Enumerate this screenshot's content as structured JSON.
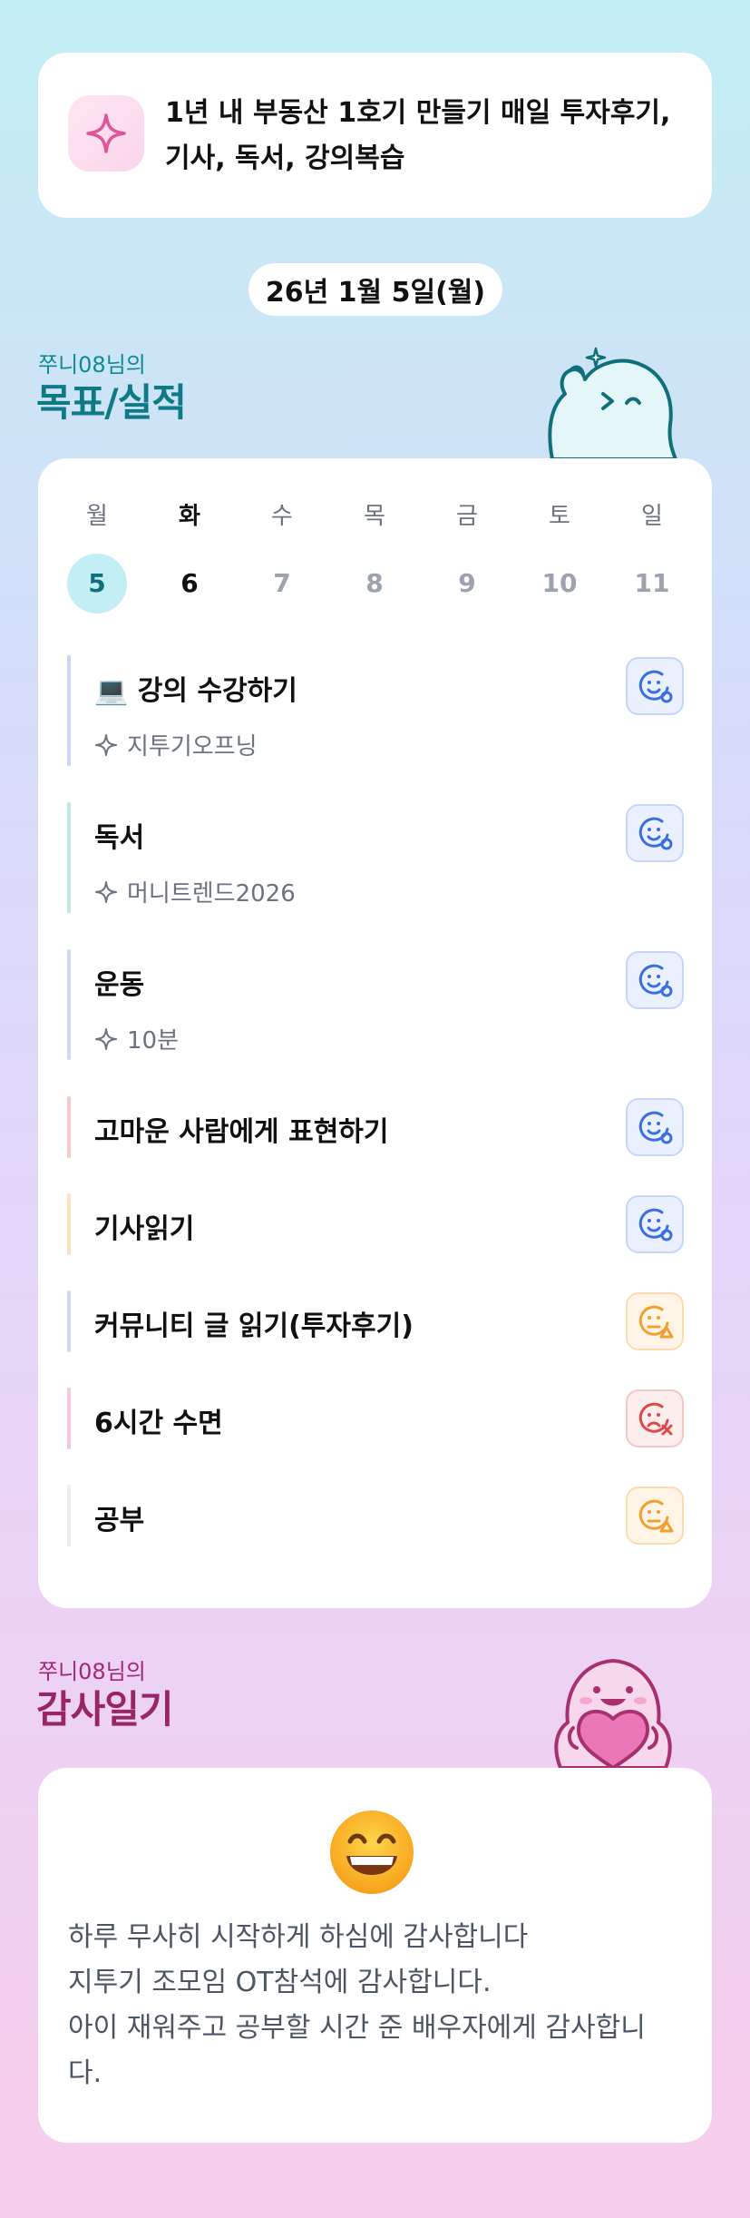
{
  "goal": {
    "icon": "sparkle-icon",
    "text": "1년 내 부동산 1호기 만들기 매일 투자후기, 기사, 독서, 강의복습"
  },
  "date": "26년 1월 5일(월)",
  "goals_section": {
    "owner": "쭈니08님의",
    "title": "목표/실적"
  },
  "week": {
    "weekdays": [
      "월",
      "화",
      "수",
      "목",
      "금",
      "토",
      "일"
    ],
    "days": [
      "5",
      "6",
      "7",
      "8",
      "9",
      "10",
      "11"
    ],
    "selected_index": 0,
    "today_index": 1
  },
  "tasks": [
    {
      "label": "💻 강의 수강하기",
      "sub": "지투기오프닝",
      "status": "done",
      "status_icon": "smile-check-icon",
      "bar_color": "#c9d6f7"
    },
    {
      "label": "독서",
      "sub": "머니트렌드2026",
      "status": "done",
      "status_icon": "smile-check-icon",
      "bar_color": "#bfe8d6"
    },
    {
      "label": "운동",
      "sub": "10분",
      "status": "done",
      "status_icon": "smile-check-icon",
      "bar_color": "#cdd9f6"
    },
    {
      "label": "고마운 사람에게 표현하기",
      "sub": "",
      "status": "done",
      "status_icon": "smile-check-icon",
      "bar_color": "#f8c9c9"
    },
    {
      "label": "기사읽기",
      "sub": "",
      "status": "done",
      "status_icon": "smile-check-icon",
      "bar_color": "#fde2c1"
    },
    {
      "label": "커뮤니티 글 읽기(투자후기)",
      "sub": "",
      "status": "partial",
      "status_icon": "meh-warning-icon",
      "bar_color": "#cdd8f5"
    },
    {
      "label": "6시간 수면",
      "sub": "",
      "status": "fail",
      "status_icon": "sad-x-icon",
      "bar_color": "#f6c7e0"
    },
    {
      "label": "공부",
      "sub": "",
      "status": "partial",
      "status_icon": "meh-warning-icon",
      "bar_color": "#eceef1"
    }
  ],
  "thanks_section": {
    "owner": "쭈니08님의",
    "title": "감사일기",
    "emoji": "grinning-face-icon",
    "lines": [
      "하루 무사히 시작하게 하심에 감사합니다",
      "지투기 조모임 OT참석에 감사합니다.",
      "아이 재워주고 공부할 시간 준 배우자에게 감사합니",
      "다."
    ]
  },
  "colors": {
    "teal": "#0e7a86",
    "pink": "#982568",
    "status_ok": "#3b6fe0",
    "status_warn": "#f0a030",
    "status_bad": "#e04848"
  }
}
